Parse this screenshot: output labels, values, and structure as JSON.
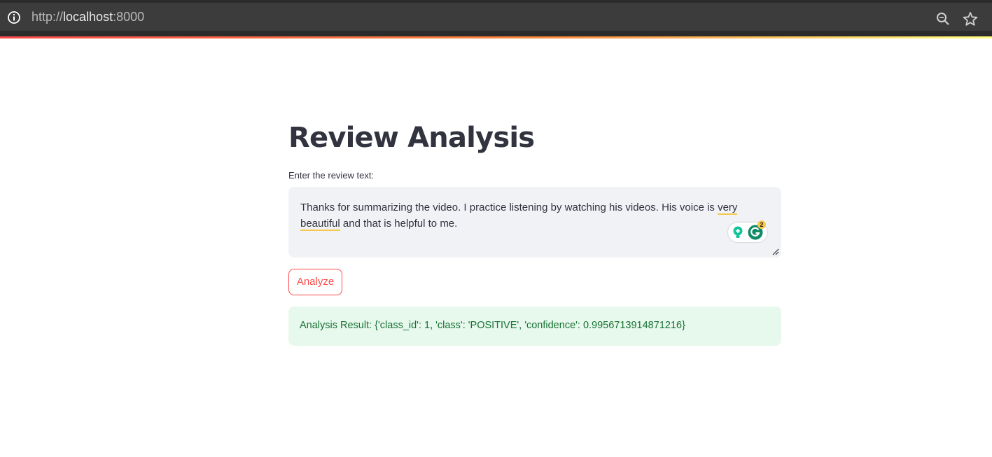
{
  "browser": {
    "url_scheme": "http://",
    "url_host": "localhost",
    "url_port": ":8000"
  },
  "page": {
    "title": "Review Analysis",
    "input_label": "Enter the review text:",
    "review_text_part1": "Thanks for summarizing the video. I practice listening by watching his videos. His voice is ",
    "review_text_underlined": "very beautiful",
    "review_text_part2": " and that is helpful to me.",
    "grammarly_badge_count": "2",
    "analyze_button_label": "Analyze",
    "result_text": "Analysis Result: {'class_id': 1, 'class': 'POSITIVE', 'confidence': 0.9956713914871216}"
  },
  "icons": {
    "info": "info-icon",
    "zoom": "zoom-icon",
    "star": "bookmark-star-icon",
    "bulb": "grammarly-lightbulb-icon",
    "grammarly": "grammarly-g-icon",
    "resize": "resize-grip-icon"
  },
  "colors": {
    "accent": "#ff4b4b",
    "success_bg": "#e7f8ed",
    "success_text": "#177233",
    "textarea_bg": "#f0f2f6",
    "underline": "#f6c84c"
  }
}
